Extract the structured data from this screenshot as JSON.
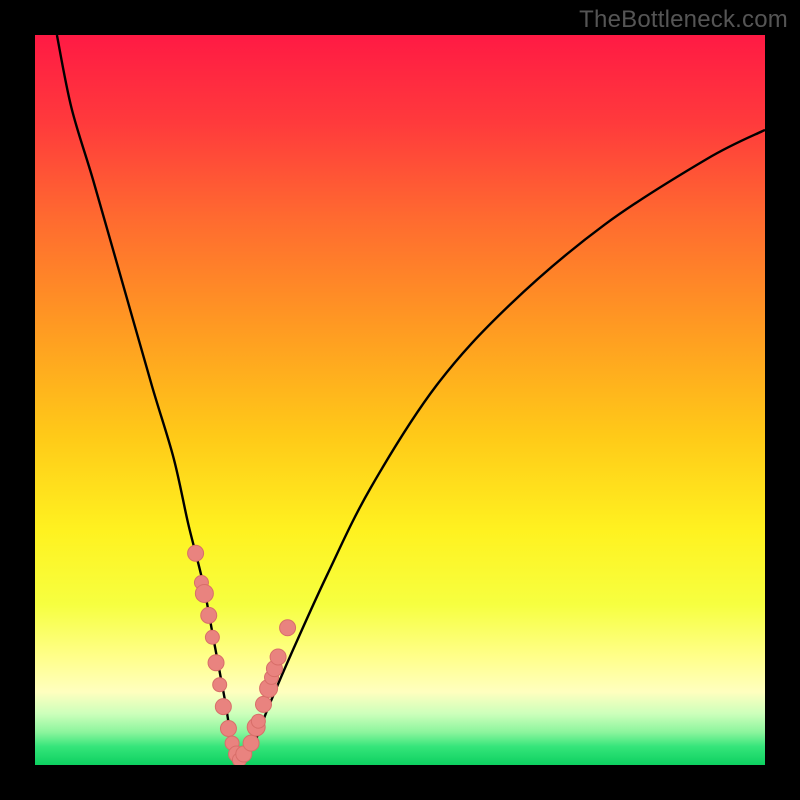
{
  "watermark": "TheBottleneck.com",
  "colors": {
    "gradient_stops": [
      {
        "pos": 0.0,
        "color": "#ff1a44"
      },
      {
        "pos": 0.12,
        "color": "#ff3a3c"
      },
      {
        "pos": 0.25,
        "color": "#ff6a30"
      },
      {
        "pos": 0.4,
        "color": "#ff9a22"
      },
      {
        "pos": 0.55,
        "color": "#ffca18"
      },
      {
        "pos": 0.68,
        "color": "#fff220"
      },
      {
        "pos": 0.78,
        "color": "#f6ff40"
      },
      {
        "pos": 0.85,
        "color": "#ffff88"
      },
      {
        "pos": 0.9,
        "color": "#ffffbf"
      },
      {
        "pos": 0.93,
        "color": "#ccffbb"
      },
      {
        "pos": 0.955,
        "color": "#8cf59d"
      },
      {
        "pos": 0.975,
        "color": "#35e57a"
      },
      {
        "pos": 1.0,
        "color": "#0dd060"
      }
    ],
    "curve": "#000000",
    "marker_fill": "#e9837f",
    "marker_stroke": "#d86e69"
  },
  "chart_data": {
    "type": "line",
    "title": "",
    "xlabel": "",
    "ylabel": "",
    "xlim": [
      0,
      100
    ],
    "ylim": [
      0,
      100
    ],
    "grid": false,
    "series": [
      {
        "name": "bottleneck-curve",
        "x": [
          3,
          5,
          8,
          12,
          16,
          19,
          21,
          23,
          24.5,
          26,
          27,
          28,
          30,
          32,
          35,
          40,
          46,
          55,
          65,
          78,
          92,
          100
        ],
        "y": [
          100,
          90,
          80,
          66,
          52,
          42,
          33,
          25,
          17,
          9,
          3,
          0.5,
          3,
          8,
          15,
          26,
          38,
          52,
          63,
          74,
          83,
          87
        ]
      }
    ],
    "markers": {
      "name": "highlighted-points",
      "x": [
        22.0,
        22.8,
        23.2,
        23.8,
        24.3,
        24.8,
        25.3,
        25.8,
        26.5,
        27.0,
        27.6,
        28.0,
        28.6,
        29.6,
        30.3,
        30.6,
        31.3,
        32.0,
        32.4,
        32.8,
        33.3,
        34.6
      ],
      "y": [
        29.0,
        25.0,
        23.5,
        20.5,
        17.5,
        14.0,
        11.0,
        8.0,
        5.0,
        3.0,
        1.5,
        0.7,
        1.5,
        3.0,
        5.2,
        6.0,
        8.3,
        10.5,
        12.0,
        13.2,
        14.8,
        18.8
      ],
      "r": [
        8,
        7,
        9,
        8,
        7,
        8,
        7,
        8,
        8,
        7,
        8,
        7,
        8,
        8,
        9,
        7,
        8,
        9,
        7,
        8,
        8,
        8
      ]
    }
  }
}
